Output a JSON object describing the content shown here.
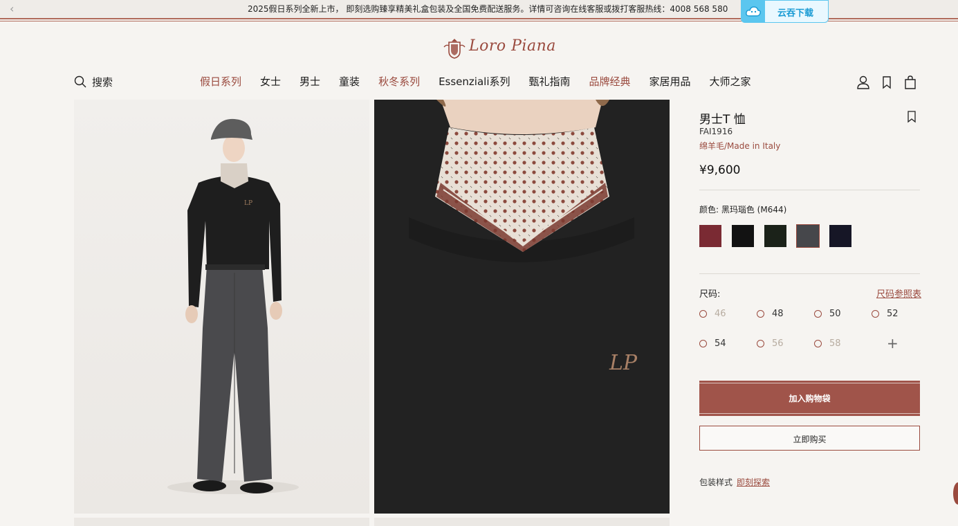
{
  "announcement": {
    "text": "2025假日系列全新上市， 即刻选购臻享精美礼盒包装及全国免费配送服务。详情可咨询在线客服或拨打客服热线：4008 568 580"
  },
  "yuntun": {
    "label": "云吞下载"
  },
  "brand": {
    "name": "Loro Piana"
  },
  "search": {
    "label": "搜索"
  },
  "nav": {
    "items": [
      {
        "label": "假日系列"
      },
      {
        "label": "女士"
      },
      {
        "label": "男士"
      },
      {
        "label": "童装"
      },
      {
        "label": "秋冬系列"
      },
      {
        "label": "Essenziali系列"
      },
      {
        "label": "甄礼指南"
      },
      {
        "label": "品牌经典"
      },
      {
        "label": "家居用品"
      },
      {
        "label": "大师之家"
      }
    ]
  },
  "product": {
    "title": "男士T 恤",
    "sku": "FAI1916",
    "material": "绵羊毛/Made in Italy",
    "price": "¥9,600",
    "color_label": "颜色: 黑玛瑙色 (M644)",
    "swatches": [
      "#7a2a33",
      "#121212",
      "#1b2219",
      "#46474b",
      "#161626"
    ],
    "selected_swatch": 3,
    "size_label": "尺码:",
    "size_chart": "尺码参照表",
    "sizes": [
      {
        "label": "46",
        "available": false
      },
      {
        "label": "48",
        "available": true
      },
      {
        "label": "50",
        "available": true
      },
      {
        "label": "52",
        "available": true
      },
      {
        "label": "54",
        "available": true
      },
      {
        "label": "56",
        "available": false
      },
      {
        "label": "58",
        "available": false
      }
    ],
    "add_to_bag": "加入购物袋",
    "buy_now": "立即购买",
    "packaging_label": "包装样式",
    "packaging_link": "即刻探索"
  },
  "colors": {
    "accent": "#9a4a3e",
    "button": "#a0544a",
    "background": "#f6f4f1"
  }
}
